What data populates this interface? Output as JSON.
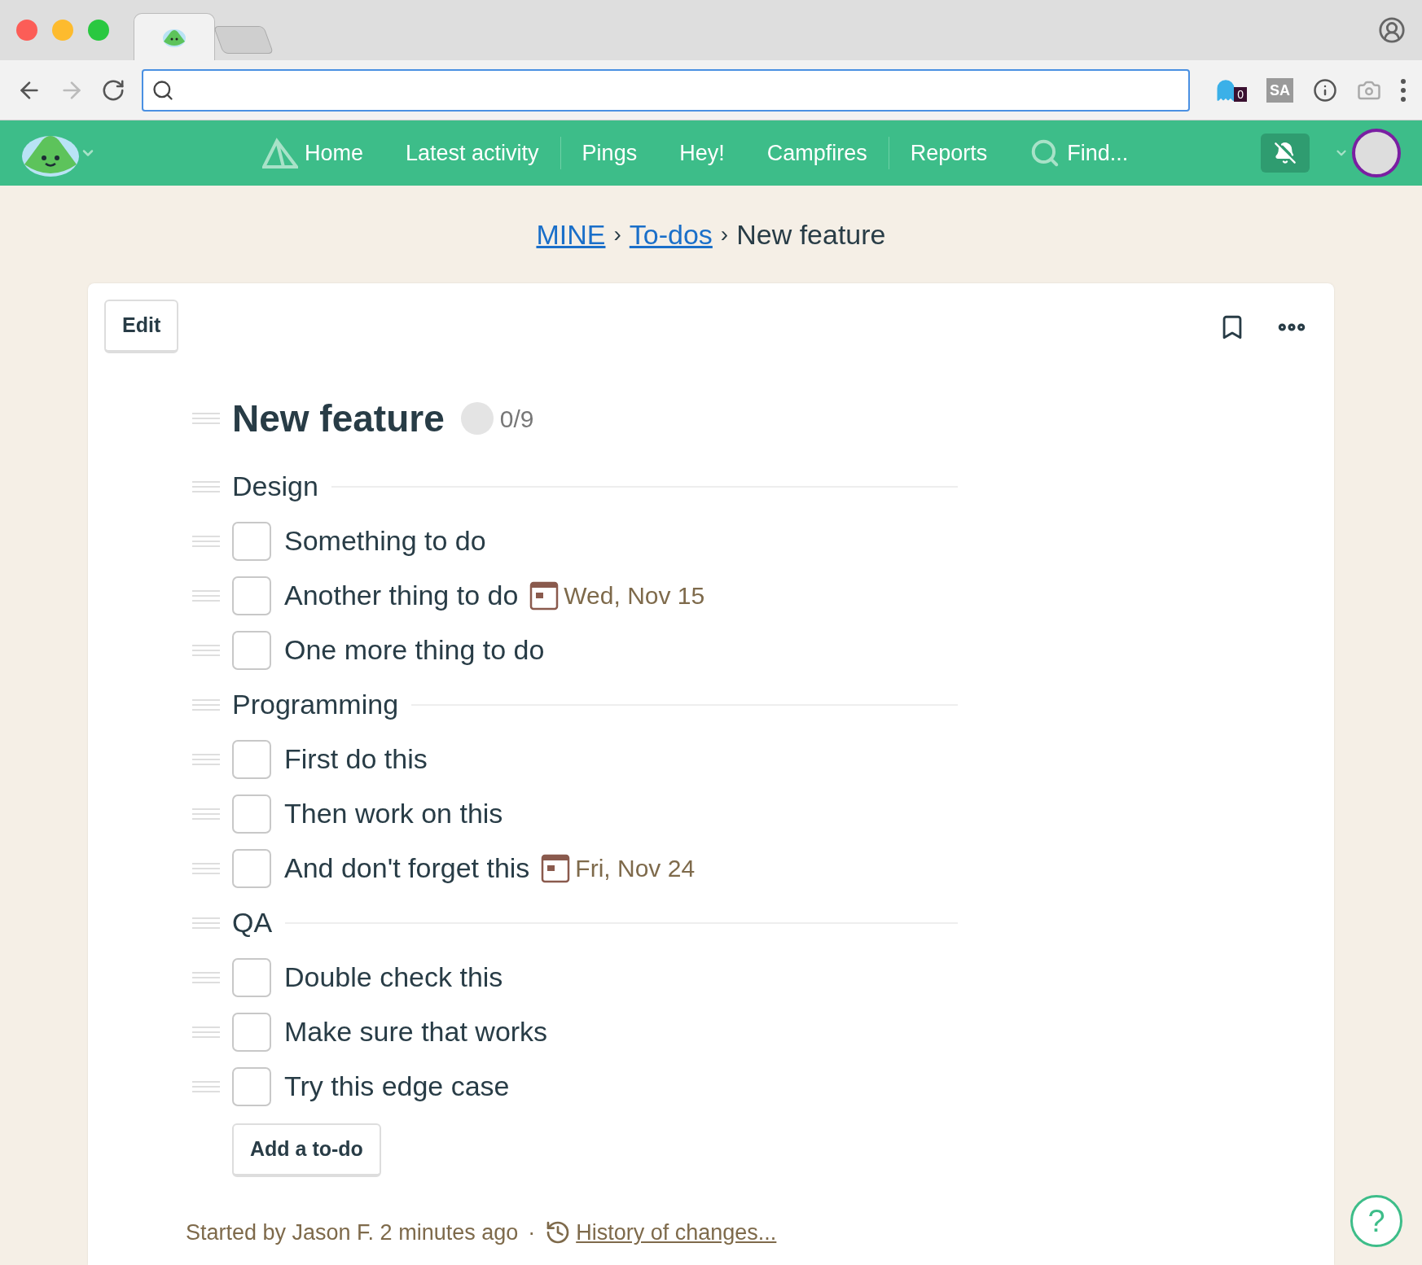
{
  "browser": {
    "tabs": [
      {
        "selected": true
      },
      {
        "selected": false
      }
    ],
    "extensions": [
      {
        "kind": "ghost",
        "badge": "0"
      },
      {
        "kind": "sa",
        "label": "SA"
      },
      {
        "kind": "info"
      },
      {
        "kind": "camera"
      }
    ]
  },
  "nav": {
    "groups": [
      [
        {
          "label": "Home",
          "kind": "home"
        },
        {
          "label": "Latest activity",
          "kind": "plain"
        }
      ],
      [
        {
          "label": "Pings",
          "kind": "plain"
        },
        {
          "label": "Hey!",
          "kind": "plain"
        },
        {
          "label": "Campfires",
          "kind": "plain"
        }
      ],
      [
        {
          "label": "Reports",
          "kind": "plain"
        },
        {
          "label": "Find...",
          "kind": "search"
        }
      ]
    ],
    "notifications_muted": true
  },
  "breadcrumb": [
    {
      "label": "MINE",
      "kind": "link"
    },
    {
      "label": "›",
      "kind": "sep"
    },
    {
      "label": "To-dos",
      "kind": "link"
    },
    {
      "label": "›",
      "kind": "sep"
    },
    {
      "label": "New feature",
      "kind": "current"
    }
  ],
  "card": {
    "edit_button": "Edit",
    "list": {
      "title": "New feature",
      "progress": "0/9",
      "groups": [
        {
          "name": "Design",
          "todos": [
            {
              "text": "Something to do",
              "checked": false
            },
            {
              "text": "Another thing to do",
              "checked": false,
              "due": "Wed, Nov 15"
            },
            {
              "text": "One more thing to do",
              "checked": false
            }
          ]
        },
        {
          "name": "Programming",
          "todos": [
            {
              "text": "First do this",
              "checked": false
            },
            {
              "text": "Then work on this",
              "checked": false
            },
            {
              "text": "And don't forget this",
              "checked": false,
              "due": "Fri, Nov 24"
            }
          ]
        },
        {
          "name": "QA",
          "todos": [
            {
              "text": "Double check this",
              "checked": false
            },
            {
              "text": "Make sure that works",
              "checked": false
            },
            {
              "text": "Try this edge case",
              "checked": false
            }
          ]
        }
      ]
    },
    "add_button": "Add a to-do",
    "footer": {
      "started": "Started by Jason F. 2 minutes ago",
      "separator": "·",
      "history_link": "History of changes..."
    }
  },
  "help": "?"
}
